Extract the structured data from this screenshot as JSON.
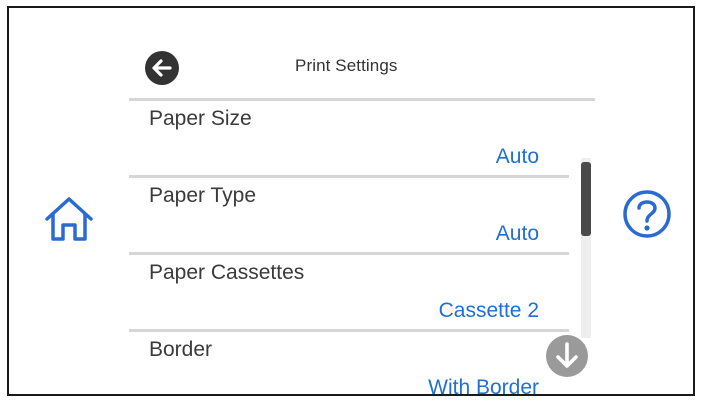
{
  "header": {
    "title": "Print Settings",
    "back_icon": "back-arrow-icon"
  },
  "nav": {
    "home_icon": "home-icon",
    "help_icon": "help-icon",
    "scroll_down_icon": "arrow-down-icon"
  },
  "settings": [
    {
      "label": "Paper Size",
      "value": "Auto"
    },
    {
      "label": "Paper Type",
      "value": "Auto"
    },
    {
      "label": "Paper Cassettes",
      "value": "Cassette 2"
    },
    {
      "label": "Border",
      "value": "With Border"
    }
  ],
  "colors": {
    "value_text": "#1f6fd6",
    "accent_icon": "#2a6bd1",
    "dark_button": "#333333",
    "scroll_down_button": "#9a9a9a"
  }
}
